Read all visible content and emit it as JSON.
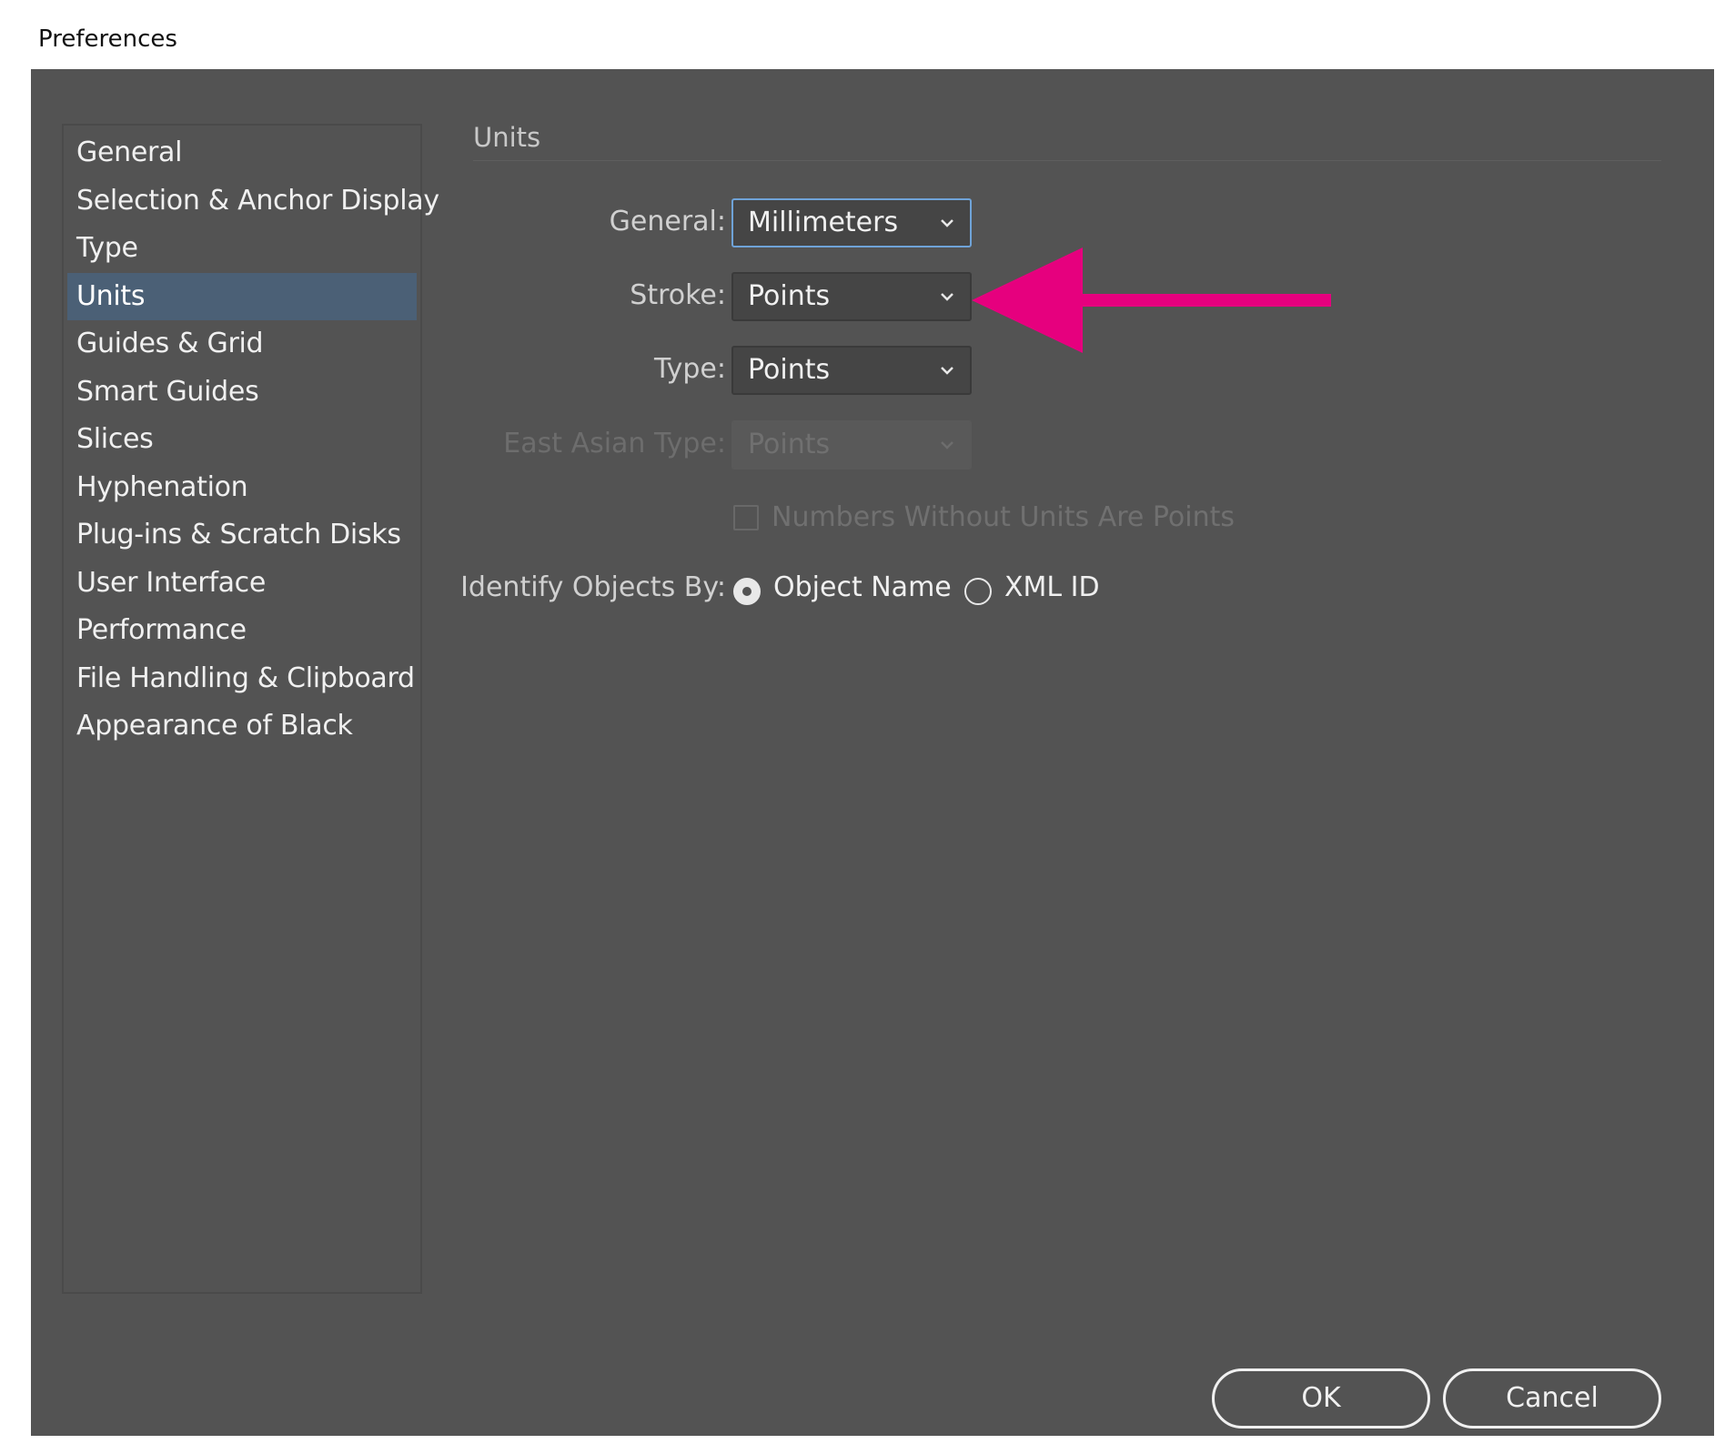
{
  "window": {
    "title": "Preferences"
  },
  "sidebar": {
    "items": [
      {
        "label": "General",
        "selected": false
      },
      {
        "label": "Selection & Anchor Display",
        "selected": false
      },
      {
        "label": "Type",
        "selected": false
      },
      {
        "label": "Units",
        "selected": true
      },
      {
        "label": "Guides & Grid",
        "selected": false
      },
      {
        "label": "Smart Guides",
        "selected": false
      },
      {
        "label": "Slices",
        "selected": false
      },
      {
        "label": "Hyphenation",
        "selected": false
      },
      {
        "label": "Plug-ins & Scratch Disks",
        "selected": false
      },
      {
        "label": "User Interface",
        "selected": false
      },
      {
        "label": "Performance",
        "selected": false
      },
      {
        "label": "File Handling & Clipboard",
        "selected": false
      },
      {
        "label": "Appearance of Black",
        "selected": false
      }
    ]
  },
  "main": {
    "section_title": "Units",
    "general": {
      "label": "General:",
      "value": "Millimeters"
    },
    "stroke": {
      "label": "Stroke:",
      "value": "Points"
    },
    "type": {
      "label": "Type:",
      "value": "Points"
    },
    "east_asian_type": {
      "label": "East Asian Type:",
      "value": "Points",
      "disabled": true
    },
    "numbers_without_units": {
      "label": "Numbers Without Units Are Points",
      "checked": false,
      "disabled": true
    },
    "identify_objects": {
      "label": "Identify Objects By:",
      "options": [
        {
          "label": "Object Name",
          "checked": true
        },
        {
          "label": "XML ID",
          "checked": false
        }
      ]
    }
  },
  "buttons": {
    "ok": "OK",
    "cancel": "Cancel"
  },
  "annotation": {
    "arrow_color": "#e6007e",
    "points_to": "stroke-dropdown"
  },
  "colors": {
    "dialog_bg": "#535353",
    "selected_item_bg": "#4b6076",
    "focus_border": "#6fa3d8"
  }
}
